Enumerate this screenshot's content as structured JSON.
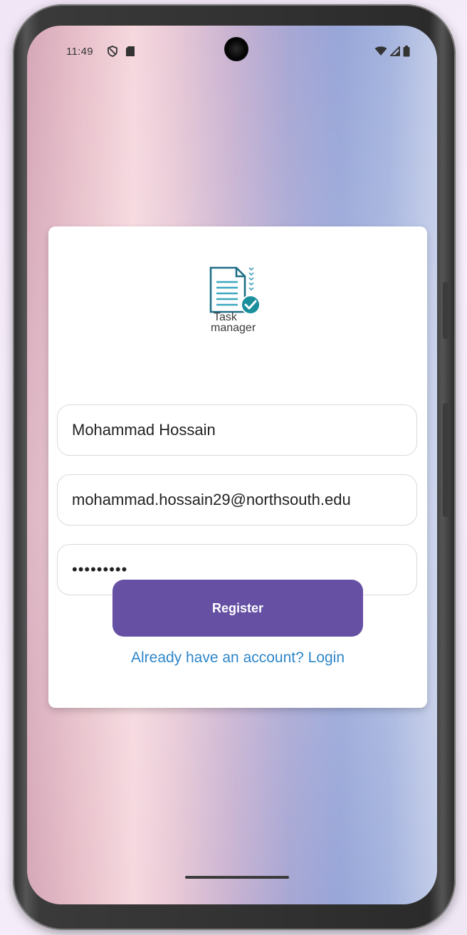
{
  "status_bar": {
    "time": "11:49",
    "left_icons": [
      "shield-icon",
      "sd-card-icon"
    ],
    "right_icons": [
      "wifi-icon",
      "signal-icon",
      "battery-icon"
    ]
  },
  "logo": {
    "line1": "Task",
    "line2": "manager",
    "accent_color": "#1a8f9c"
  },
  "form": {
    "name_value": "Mohammad Hossain",
    "email_value": "mohammad.hossain29@northsouth.edu",
    "password_value": "•••••••••"
  },
  "actions": {
    "register_label": "Register",
    "login_link": "Already have an account? Login"
  },
  "colors": {
    "primary_button": "#6650a4",
    "link": "#2e86c9"
  }
}
